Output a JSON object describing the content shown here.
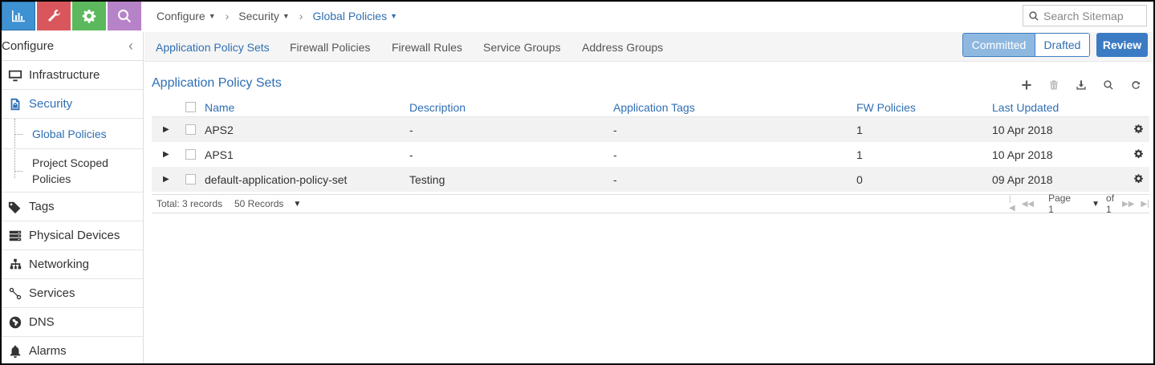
{
  "modules": [
    {
      "icon": "bar-chart-icon",
      "color": "#3f92d2"
    },
    {
      "icon": "wrench-icon",
      "color": "#d9575c"
    },
    {
      "icon": "gear-icon",
      "color": "#5cb85c"
    },
    {
      "icon": "search-icon",
      "color": "#b783c8"
    }
  ],
  "sidebar": {
    "title": "Configure",
    "items": [
      {
        "label": "Infrastructure",
        "icon": "monitor-icon"
      },
      {
        "label": "Security",
        "icon": "security-icon"
      },
      {
        "label": "Tags",
        "icon": "tags-icon"
      },
      {
        "label": "Physical Devices",
        "icon": "server-icon"
      },
      {
        "label": "Networking",
        "icon": "network-icon"
      },
      {
        "label": "Services",
        "icon": "link-icon"
      },
      {
        "label": "DNS",
        "icon": "globe-icon"
      },
      {
        "label": "Alarms",
        "icon": "bell-icon"
      }
    ],
    "subitems": [
      {
        "label": "Global Policies"
      },
      {
        "label": "Project Scoped Policies"
      }
    ]
  },
  "breadcrumb": {
    "items": [
      "Configure",
      "Security",
      "Global Policies"
    ]
  },
  "search": {
    "placeholder": "Search Sitemap"
  },
  "tabs": [
    "Application Policy Sets",
    "Firewall Policies",
    "Firewall Rules",
    "Service Groups",
    "Address Groups"
  ],
  "toggle": {
    "committed": "Committed",
    "drafted": "Drafted"
  },
  "review_label": "Review",
  "grid": {
    "title": "Application Policy Sets",
    "columns": [
      "Name",
      "Description",
      "Application Tags",
      "FW Policies",
      "Last Updated"
    ],
    "rows": [
      {
        "name": "APS2",
        "description": "-",
        "tags": "-",
        "fw": "1",
        "updated": "10 Apr 2018"
      },
      {
        "name": "APS1",
        "description": "-",
        "tags": "-",
        "fw": "1",
        "updated": "10 Apr 2018"
      },
      {
        "name": "default-application-policy-set",
        "description": "Testing",
        "tags": "-",
        "fw": "0",
        "updated": "09 Apr 2018"
      }
    ],
    "total": "Total: 3 records",
    "per_page": "50 Records",
    "page_label": "Page 1",
    "page_of": "of 1"
  }
}
